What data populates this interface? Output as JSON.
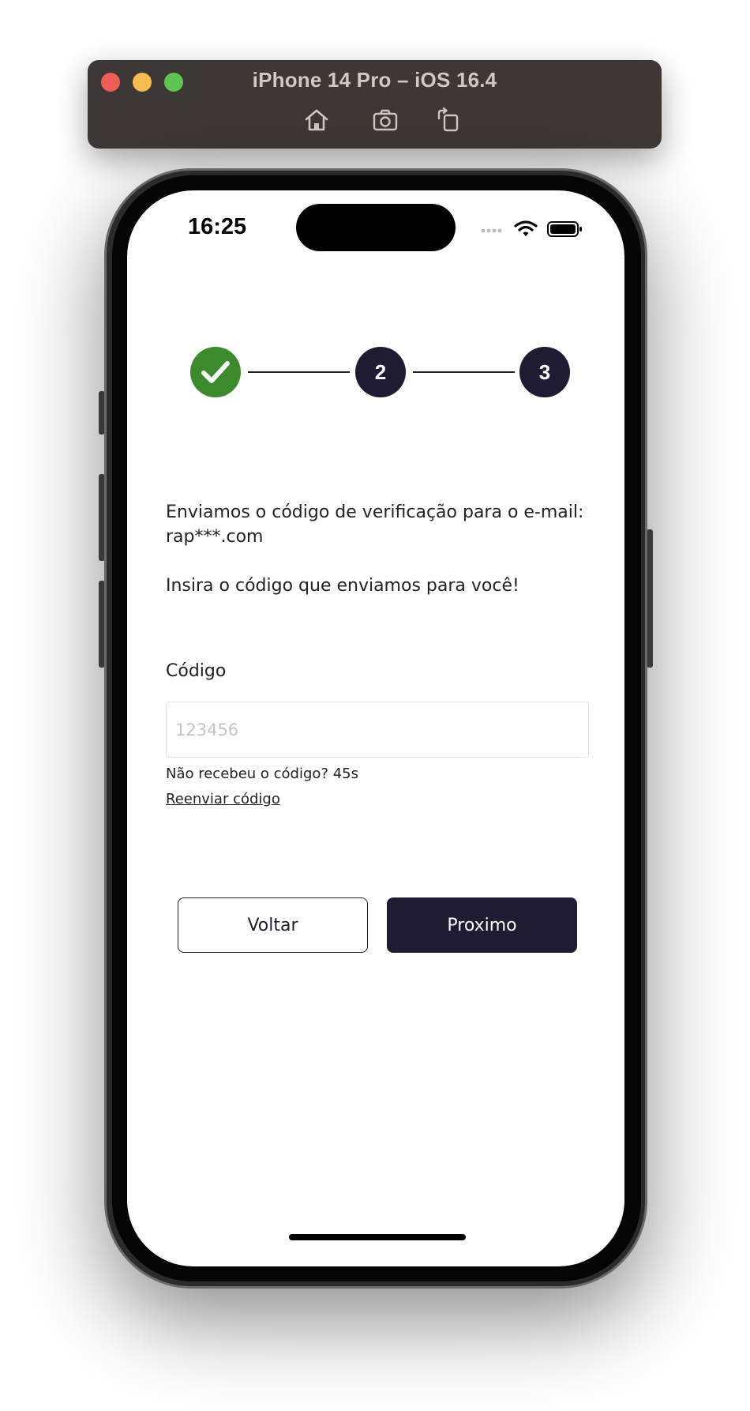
{
  "simulator": {
    "title": "iPhone 14 Pro – iOS 16.4",
    "toolbar_icons": [
      "home-icon",
      "screenshot-icon",
      "rotate-icon"
    ]
  },
  "status_bar": {
    "time": "16:25",
    "icons": [
      "cellular-icon",
      "wifi-icon",
      "battery-icon"
    ]
  },
  "stepper": {
    "steps": [
      {
        "label": "",
        "state": "completed",
        "icon": "check-icon",
        "color": "#3b8a2c"
      },
      {
        "label": "2",
        "state": "current",
        "color": "#1e1b33"
      },
      {
        "label": "3",
        "state": "pending",
        "color": "#1e1b33"
      }
    ]
  },
  "content": {
    "intro": "Enviamos o código de verificação para o e-mail: rap***.com",
    "instruction": "Insira o código que enviamos para você!",
    "code_label": "Código",
    "code_value": "",
    "code_placeholder": "123456",
    "resend_info": "Não recebeu o código? 45s",
    "resend_link": "Reenviar código"
  },
  "actions": {
    "back_label": "Voltar",
    "next_label": "Proximo"
  },
  "colors": {
    "primary": "#1e1b33",
    "success": "#3b8a2c"
  }
}
